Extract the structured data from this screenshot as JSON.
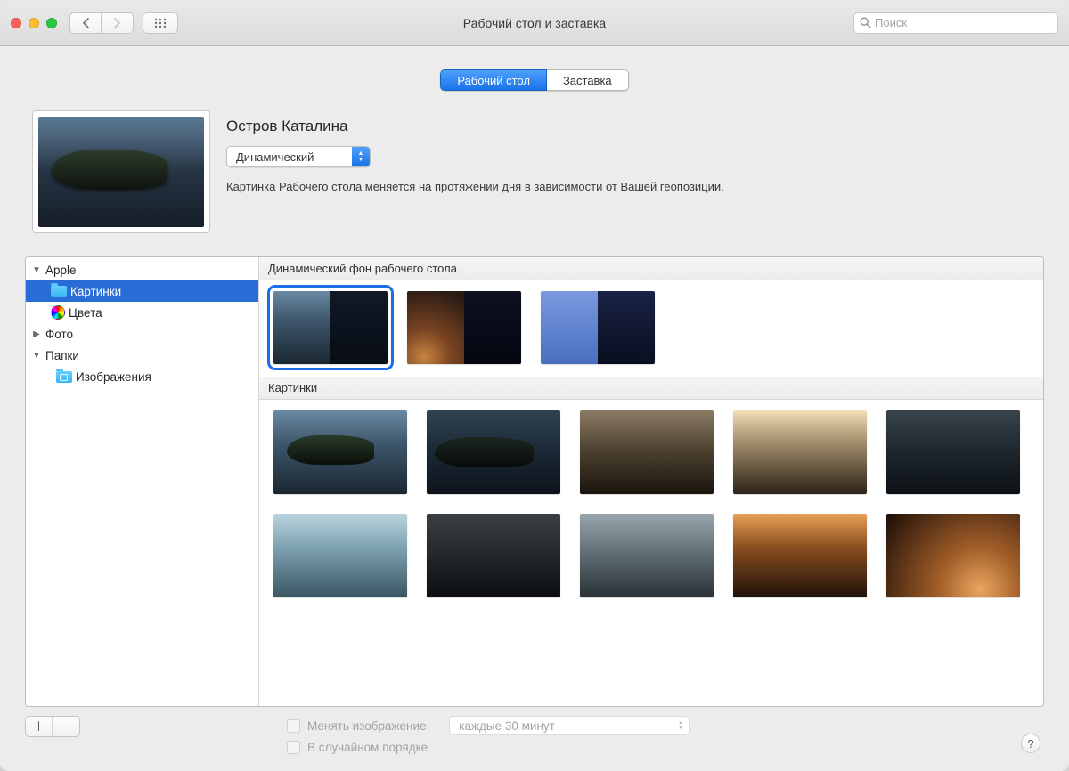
{
  "titlebar": {
    "title": "Рабочий стол и заставка",
    "search_placeholder": "Поиск"
  },
  "tabs": {
    "desktop": "Рабочий стол",
    "saver": "Заставка"
  },
  "header": {
    "name": "Остров Каталина",
    "mode": "Динамический",
    "desc": "Картинка Рабочего стола меняется на протяжении дня в зависимости от Вашей геопозиции."
  },
  "sidebar": {
    "apple": "Apple",
    "pictures": "Картинки",
    "colors": "Цвета",
    "photo": "Фото",
    "folders": "Папки",
    "images": "Изображения"
  },
  "sections": {
    "dynamic": "Динамический фон рабочего стола",
    "pictures": "Картинки"
  },
  "footer": {
    "change": "Менять изображение:",
    "interval": "каждые 30 минут",
    "random": "В случайном порядке"
  }
}
